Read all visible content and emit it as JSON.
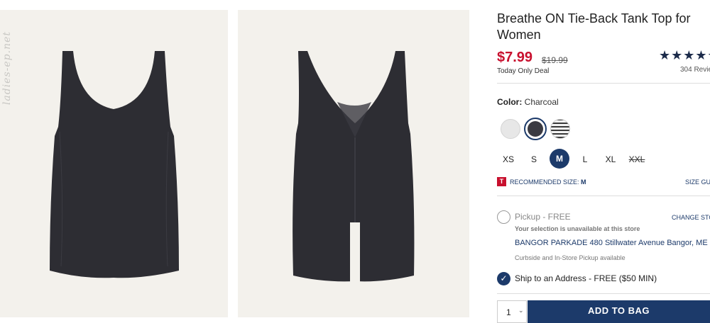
{
  "product": {
    "title": "Breathe ON Tie-Back Tank Top for Women",
    "price": "$7.99",
    "price_old": "$19.99",
    "deal_text": "Today Only Deal",
    "rating_stars": "★★★★★",
    "reviews": "304 Revie"
  },
  "images": {
    "watermark": "ladies-ep.net",
    "garment_color": "#2d2d33"
  },
  "color": {
    "label": "Color:",
    "value": "Charcoal",
    "swatches": [
      "light-gray",
      "charcoal",
      "stripe"
    ]
  },
  "sizes": [
    {
      "label": "XS"
    },
    {
      "label": "S"
    },
    {
      "label": "M",
      "selected": true
    },
    {
      "label": "L"
    },
    {
      "label": "XL"
    },
    {
      "label": "XXL",
      "unavailable": true
    }
  ],
  "recommended": {
    "icon": "T",
    "text": "RECOMMENDED SIZE:",
    "size": "M",
    "size_guide": "SIZE GU"
  },
  "fulfillment": {
    "pickup_label": "Pickup - FREE",
    "change_store": "CHANGE STO",
    "unavailable": "Your selection is unavailable at this store",
    "store_address": "BANGOR PARKADE 480 Stillwater Avenue  Bangor, ME",
    "curbside": "Curbside and In-Store Pickup available",
    "ship_label": "Ship to an Address - FREE ($50 MIN)"
  },
  "cart": {
    "quantity": "1",
    "add_button": "ADD TO BAG"
  },
  "colors": {
    "accent": "#1c3a6a",
    "sale": "#c8102e"
  }
}
